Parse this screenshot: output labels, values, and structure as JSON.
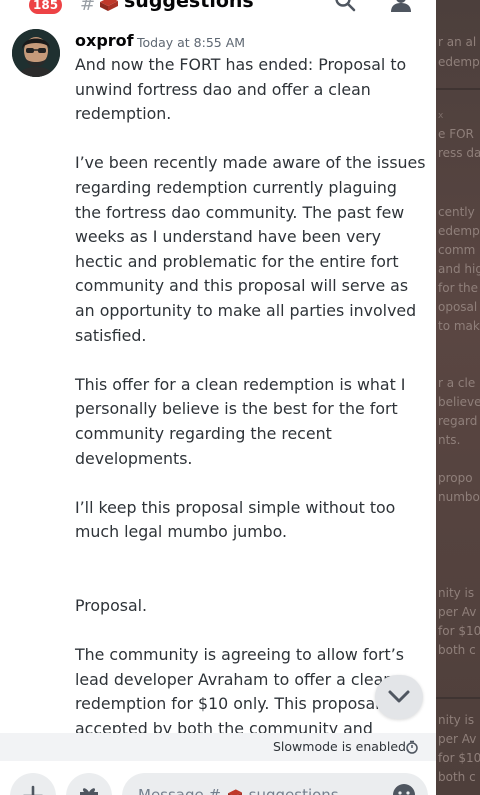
{
  "header": {
    "unread_count": "185",
    "channel_name": "suggestions"
  },
  "message": {
    "author": "oxprof",
    "timestamp": "Today at 8:55 AM",
    "paragraphs": [
      "And now the FORT has ended: Proposal to unwind fortress dao and offer a clean redemption.",
      "I’ve been recently made aware of the issues regarding redemption currently plaguing the fortress dao community. The past few weeks as I understand have been very hectic and problematic for the entire fort community and this proposal will serve as an opportunity to make all parties involved satisfied.",
      "This offer for a clean redemption is what I personally believe is the best for the fort community regarding the recent developments.",
      "I’ll keep this proposal simple without too much legal mumbo jumbo.",
      "Proposal.",
      "The community is agreeing to allow fort’s lead developer Avraham to offer a clean redemption for $10 only. This proposal is accepted by both the community and"
    ]
  },
  "status": {
    "slowmode_text": "Slowmode is enabled."
  },
  "composer": {
    "placeholder": "Message #",
    "placeholder_channel": "suggestions"
  },
  "background": {
    "snippets": [
      "r an al",
      "edemp",
      "x",
      "e FOR",
      "ress da",
      "cently",
      "edempt",
      "comm",
      "and hig",
      "for the",
      "oposal",
      "to mak",
      "r a cle",
      "believe",
      "regard",
      "nts.",
      "propo",
      "numbo",
      "nity is",
      "per Av",
      "for $10",
      "both c",
      "nity is",
      "per Av",
      "for $10",
      "both c"
    ]
  },
  "colors": {
    "badge": "#ed4245",
    "text": "#2e3338",
    "muted": "#5e6772"
  }
}
